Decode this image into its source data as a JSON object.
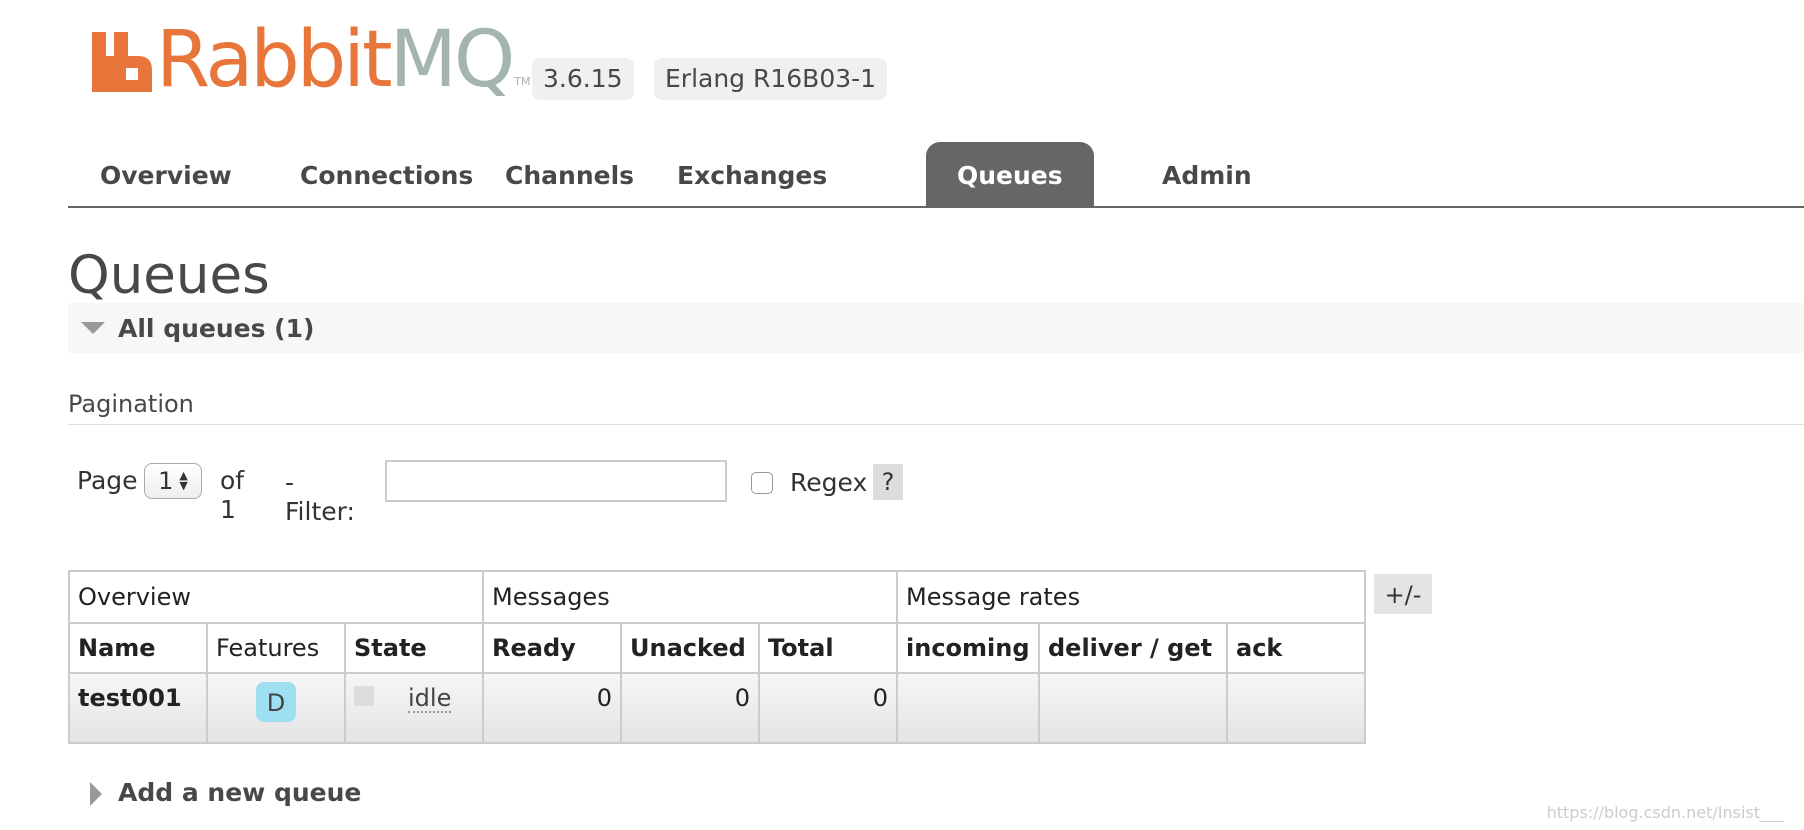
{
  "brand": {
    "logo_text_rabbit": "Rabbit",
    "logo_text_mq": "MQ",
    "logo_tm": "TM",
    "colors": {
      "orange": "#e8763a",
      "grey": "#a3b5ac"
    },
    "version": "3.6.15",
    "erlang": "Erlang R16B03-1"
  },
  "nav": {
    "tabs": [
      {
        "label": "Overview"
      },
      {
        "label": "Connections"
      },
      {
        "label": "Channels"
      },
      {
        "label": "Exchanges"
      },
      {
        "label": "Queues",
        "active": true
      },
      {
        "label": "Admin"
      }
    ]
  },
  "page": {
    "title": "Queues",
    "section_label": "All queues (1)",
    "pagination_title": "Pagination",
    "page_label": "Page",
    "page_value": "1",
    "of_label": "of 1",
    "filter_label": "- Filter:",
    "filter_value": "",
    "regex_label": "Regex",
    "help_label": "?",
    "regex_checked": false
  },
  "table": {
    "groups": [
      "Overview",
      "Messages",
      "Message rates"
    ],
    "columns": [
      "Name",
      "Features",
      "State",
      "Ready",
      "Unacked",
      "Total",
      "incoming",
      "deliver / get",
      "ack"
    ],
    "rows": [
      {
        "name": "test001",
        "feature": "D",
        "state": "idle",
        "ready": "0",
        "unacked": "0",
        "total": "0",
        "incoming": "",
        "deliver_get": "",
        "ack": ""
      }
    ],
    "toggle_columns_label": "+/-"
  },
  "add_queue": {
    "label": "Add a new queue"
  },
  "watermark": "https://blog.csdn.net/Insist___"
}
